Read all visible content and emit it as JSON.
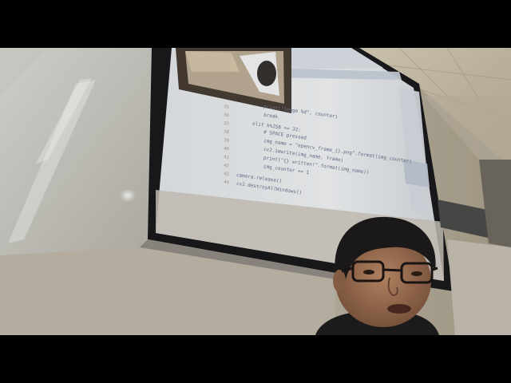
{
  "scene": {
    "description_tag": "lecture-room-photo",
    "projected_code": {
      "lines": [
        {
          "num": "35",
          "text": "print(\"Image %d\", counter)"
        },
        {
          "num": "36",
          "text": "break"
        },
        {
          "num": "37",
          "text": "elif k%256 == 32:"
        },
        {
          "num": "38",
          "text": "# SPACE pressed"
        },
        {
          "num": "39",
          "text": "img_name = \"opencv_frame_{}.png\".format(img_counter)"
        },
        {
          "num": "40",
          "text": "cv2.imwrite(img_name, frame)"
        },
        {
          "num": "41",
          "text": "print(\"{} written!\".format(img_name))"
        },
        {
          "num": "42",
          "text": "img_counter += 1"
        },
        {
          "num": "43",
          "text": "camera.release()"
        },
        {
          "num": "44",
          "text": "cv2.destroyAllWindows()"
        }
      ]
    }
  },
  "colors": {
    "wall": "#b9b4a6",
    "ceiling": "#cdc4ae",
    "screen": "#e9ecef",
    "whiteboard": "#d8d6d0",
    "skin": "#a5775a",
    "hair": "#1c1a1a"
  }
}
